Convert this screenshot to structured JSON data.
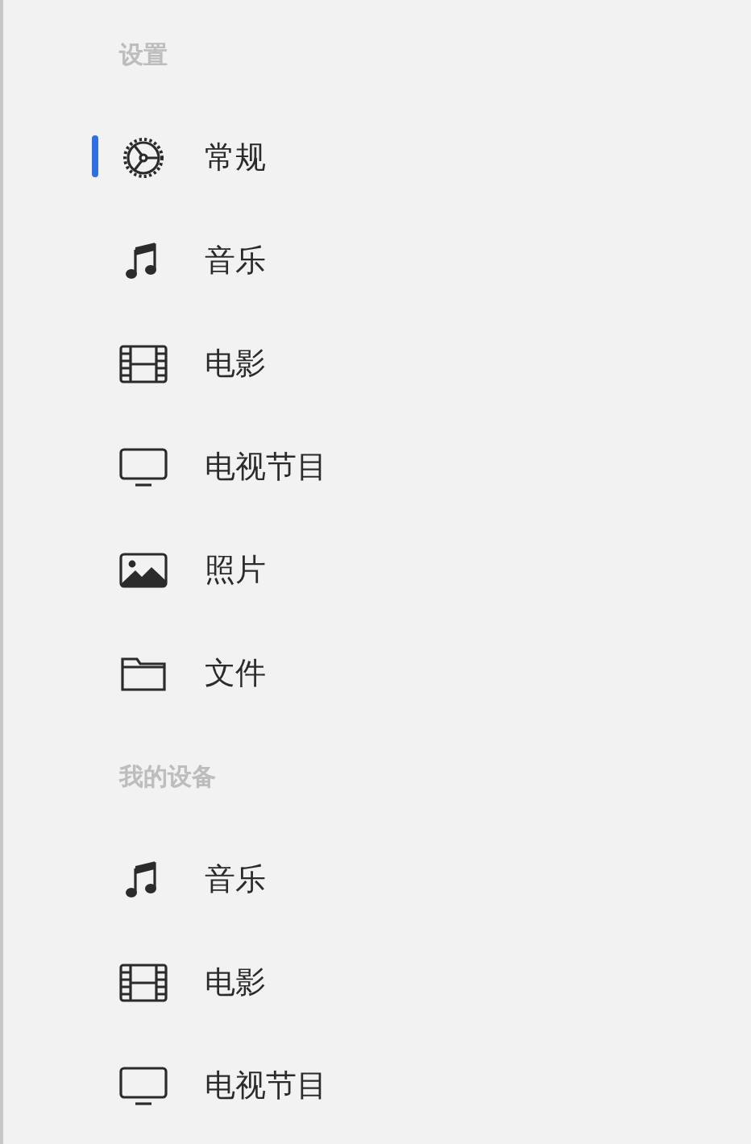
{
  "sections": [
    {
      "title": "设置",
      "items": [
        {
          "label": "常规",
          "kind": "general",
          "selected": true
        },
        {
          "label": "音乐",
          "kind": "music",
          "selected": false
        },
        {
          "label": "电影",
          "kind": "movies",
          "selected": false
        },
        {
          "label": "电视节目",
          "kind": "tv",
          "selected": false
        },
        {
          "label": "照片",
          "kind": "photos",
          "selected": false
        },
        {
          "label": "文件",
          "kind": "files",
          "selected": false
        }
      ]
    },
    {
      "title": "我的设备",
      "items": [
        {
          "label": "音乐",
          "kind": "music",
          "selected": false
        },
        {
          "label": "电影",
          "kind": "movies",
          "selected": false
        },
        {
          "label": "电视节目",
          "kind": "tv",
          "selected": false
        }
      ]
    }
  ]
}
